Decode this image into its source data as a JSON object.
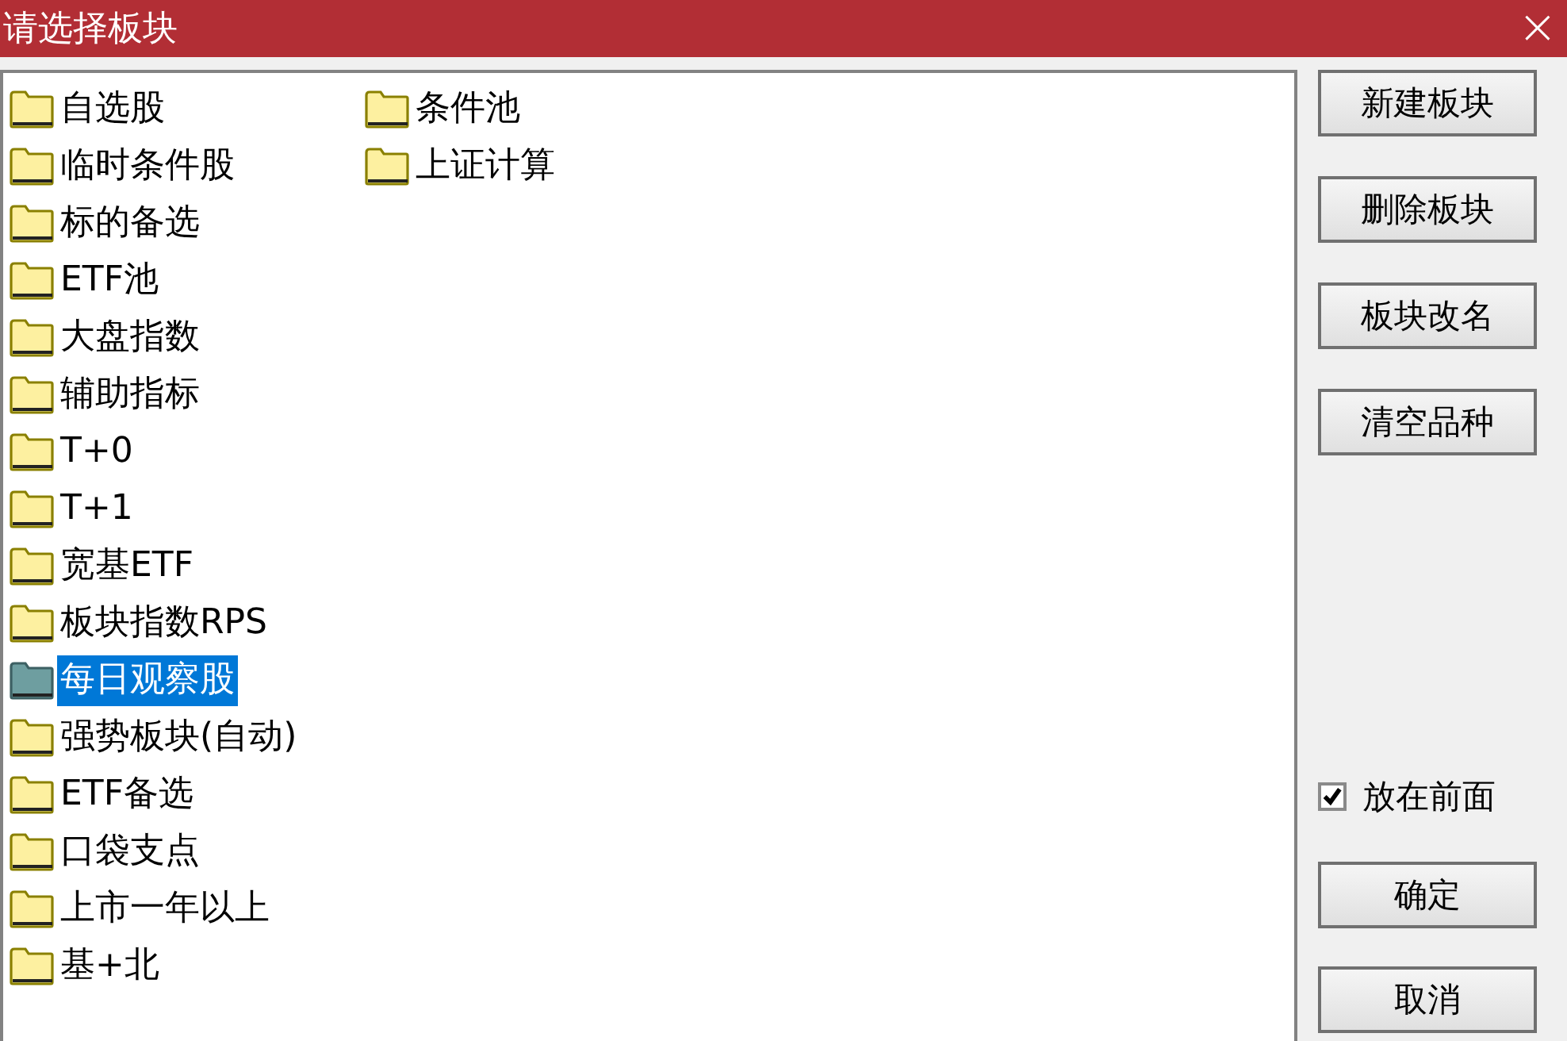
{
  "window": {
    "title": "请选择板块",
    "close": "×"
  },
  "list": {
    "items": [
      {
        "label": "自选股",
        "selected": false
      },
      {
        "label": "临时条件股",
        "selected": false
      },
      {
        "label": "标的备选",
        "selected": false
      },
      {
        "label": "ETF池",
        "selected": false
      },
      {
        "label": "大盘指数",
        "selected": false
      },
      {
        "label": "辅助指标",
        "selected": false
      },
      {
        "label": "T+0",
        "selected": false
      },
      {
        "label": "T+1",
        "selected": false
      },
      {
        "label": "宽基ETF",
        "selected": false
      },
      {
        "label": "板块指数RPS",
        "selected": false
      },
      {
        "label": "每日观察股",
        "selected": true
      },
      {
        "label": "强势板块(自动)",
        "selected": false
      },
      {
        "label": "ETF备选",
        "selected": false
      },
      {
        "label": "口袋支点",
        "selected": false
      },
      {
        "label": "上市一年以上",
        "selected": false
      },
      {
        "label": "基+北",
        "selected": false
      },
      {
        "label": "条件池",
        "selected": false
      },
      {
        "label": "上证计算",
        "selected": false
      }
    ]
  },
  "buttons": [
    "新建板块",
    "删除板块",
    "板块改名",
    "清空品种"
  ],
  "checkbox": {
    "label": "放在前面",
    "checked": true
  },
  "dialog_buttons": [
    "确定",
    "取消"
  ]
}
